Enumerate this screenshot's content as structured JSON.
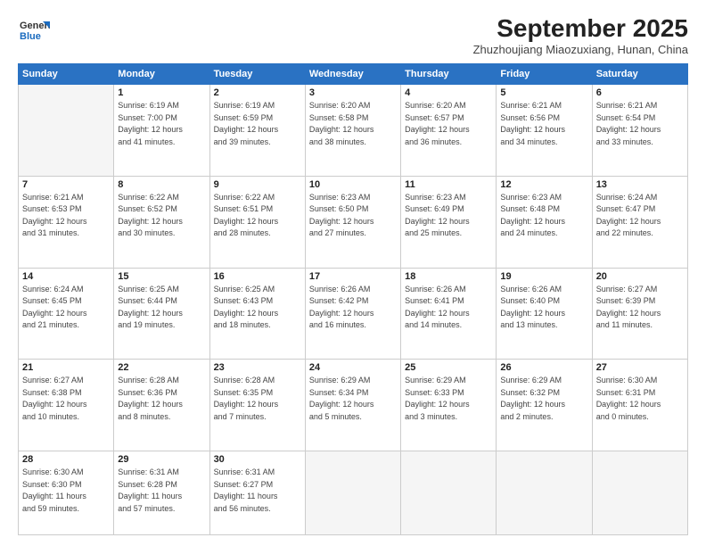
{
  "header": {
    "logo": {
      "general": "General",
      "blue": "Blue"
    },
    "title": "September 2025",
    "location": "Zhuzhoujiang Miaozuxiang, Hunan, China"
  },
  "weekdays": [
    "Sunday",
    "Monday",
    "Tuesday",
    "Wednesday",
    "Thursday",
    "Friday",
    "Saturday"
  ],
  "weeks": [
    [
      {
        "day": "",
        "info": ""
      },
      {
        "day": "1",
        "info": "Sunrise: 6:19 AM\nSunset: 7:00 PM\nDaylight: 12 hours\nand 41 minutes."
      },
      {
        "day": "2",
        "info": "Sunrise: 6:19 AM\nSunset: 6:59 PM\nDaylight: 12 hours\nand 39 minutes."
      },
      {
        "day": "3",
        "info": "Sunrise: 6:20 AM\nSunset: 6:58 PM\nDaylight: 12 hours\nand 38 minutes."
      },
      {
        "day": "4",
        "info": "Sunrise: 6:20 AM\nSunset: 6:57 PM\nDaylight: 12 hours\nand 36 minutes."
      },
      {
        "day": "5",
        "info": "Sunrise: 6:21 AM\nSunset: 6:56 PM\nDaylight: 12 hours\nand 34 minutes."
      },
      {
        "day": "6",
        "info": "Sunrise: 6:21 AM\nSunset: 6:54 PM\nDaylight: 12 hours\nand 33 minutes."
      }
    ],
    [
      {
        "day": "7",
        "info": "Sunrise: 6:21 AM\nSunset: 6:53 PM\nDaylight: 12 hours\nand 31 minutes."
      },
      {
        "day": "8",
        "info": "Sunrise: 6:22 AM\nSunset: 6:52 PM\nDaylight: 12 hours\nand 30 minutes."
      },
      {
        "day": "9",
        "info": "Sunrise: 6:22 AM\nSunset: 6:51 PM\nDaylight: 12 hours\nand 28 minutes."
      },
      {
        "day": "10",
        "info": "Sunrise: 6:23 AM\nSunset: 6:50 PM\nDaylight: 12 hours\nand 27 minutes."
      },
      {
        "day": "11",
        "info": "Sunrise: 6:23 AM\nSunset: 6:49 PM\nDaylight: 12 hours\nand 25 minutes."
      },
      {
        "day": "12",
        "info": "Sunrise: 6:23 AM\nSunset: 6:48 PM\nDaylight: 12 hours\nand 24 minutes."
      },
      {
        "day": "13",
        "info": "Sunrise: 6:24 AM\nSunset: 6:47 PM\nDaylight: 12 hours\nand 22 minutes."
      }
    ],
    [
      {
        "day": "14",
        "info": "Sunrise: 6:24 AM\nSunset: 6:45 PM\nDaylight: 12 hours\nand 21 minutes."
      },
      {
        "day": "15",
        "info": "Sunrise: 6:25 AM\nSunset: 6:44 PM\nDaylight: 12 hours\nand 19 minutes."
      },
      {
        "day": "16",
        "info": "Sunrise: 6:25 AM\nSunset: 6:43 PM\nDaylight: 12 hours\nand 18 minutes."
      },
      {
        "day": "17",
        "info": "Sunrise: 6:26 AM\nSunset: 6:42 PM\nDaylight: 12 hours\nand 16 minutes."
      },
      {
        "day": "18",
        "info": "Sunrise: 6:26 AM\nSunset: 6:41 PM\nDaylight: 12 hours\nand 14 minutes."
      },
      {
        "day": "19",
        "info": "Sunrise: 6:26 AM\nSunset: 6:40 PM\nDaylight: 12 hours\nand 13 minutes."
      },
      {
        "day": "20",
        "info": "Sunrise: 6:27 AM\nSunset: 6:39 PM\nDaylight: 12 hours\nand 11 minutes."
      }
    ],
    [
      {
        "day": "21",
        "info": "Sunrise: 6:27 AM\nSunset: 6:38 PM\nDaylight: 12 hours\nand 10 minutes."
      },
      {
        "day": "22",
        "info": "Sunrise: 6:28 AM\nSunset: 6:36 PM\nDaylight: 12 hours\nand 8 minutes."
      },
      {
        "day": "23",
        "info": "Sunrise: 6:28 AM\nSunset: 6:35 PM\nDaylight: 12 hours\nand 7 minutes."
      },
      {
        "day": "24",
        "info": "Sunrise: 6:29 AM\nSunset: 6:34 PM\nDaylight: 12 hours\nand 5 minutes."
      },
      {
        "day": "25",
        "info": "Sunrise: 6:29 AM\nSunset: 6:33 PM\nDaylight: 12 hours\nand 3 minutes."
      },
      {
        "day": "26",
        "info": "Sunrise: 6:29 AM\nSunset: 6:32 PM\nDaylight: 12 hours\nand 2 minutes."
      },
      {
        "day": "27",
        "info": "Sunrise: 6:30 AM\nSunset: 6:31 PM\nDaylight: 12 hours\nand 0 minutes."
      }
    ],
    [
      {
        "day": "28",
        "info": "Sunrise: 6:30 AM\nSunset: 6:30 PM\nDaylight: 11 hours\nand 59 minutes."
      },
      {
        "day": "29",
        "info": "Sunrise: 6:31 AM\nSunset: 6:28 PM\nDaylight: 11 hours\nand 57 minutes."
      },
      {
        "day": "30",
        "info": "Sunrise: 6:31 AM\nSunset: 6:27 PM\nDaylight: 11 hours\nand 56 minutes."
      },
      {
        "day": "",
        "info": ""
      },
      {
        "day": "",
        "info": ""
      },
      {
        "day": "",
        "info": ""
      },
      {
        "day": "",
        "info": ""
      }
    ]
  ]
}
